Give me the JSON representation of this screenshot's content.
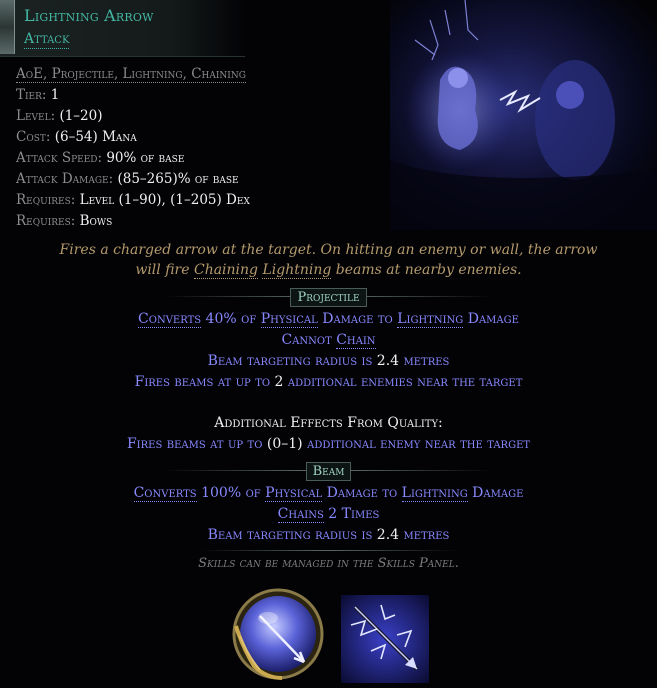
{
  "header": {
    "title": "Lightning Arrow",
    "subtitle": "Attack"
  },
  "stats": {
    "tags": "AoE, Projectile, Lightning, Chaining",
    "tier_label": "Tier:",
    "tier_value": "1",
    "level_label": "Level:",
    "level_value": "(1–20)",
    "cost_label": "Cost:",
    "cost_value": "(6–54) Mana",
    "attack_speed_label": "Attack Speed:",
    "attack_speed_value": "90% of base",
    "attack_damage_label": "Attack Damage:",
    "attack_damage_value": "(85–265)% of base",
    "requires1_label": "Requires:",
    "requires1_value": "Level (1–90), (1–205) Dex",
    "requires2_label": "Requires:",
    "requires2_value": "Bows"
  },
  "description": {
    "line1": "Fires a charged arrow at the target. On hitting an enemy or wall, the arrow",
    "line2_pre": "will fire ",
    "line2_link1": "Chaining",
    "line2_sp": " ",
    "line2_link2": "Lightning",
    "line2_post": " beams at nearby enemies."
  },
  "projectile": {
    "label": "Projectile",
    "m1": {
      "a": "Converts",
      "b": " 40% of ",
      "c": "Physical",
      "d": " Damage to ",
      "e": "Lightning",
      "f": " Damage"
    },
    "m2": {
      "a": "Cannot ",
      "b": "Chain"
    },
    "m3": {
      "a": "Beam targeting radius is ",
      "b": "2.4",
      "c": " metres"
    },
    "m4": {
      "a": "Fires beams at up to ",
      "b": "2",
      "c": " additional enemies near the target"
    }
  },
  "quality": {
    "heading": "Additional Effects From Quality:",
    "m1": {
      "a": "Fires beams at up to ",
      "b": "(0–1)",
      "c": " additional enemy near the target"
    }
  },
  "beam": {
    "label": "Beam",
    "m1": {
      "a": "Converts",
      "b": " 100% of ",
      "c": "Physical",
      "d": " Damage to ",
      "e": "Lightning",
      "f": " Damage"
    },
    "m2": {
      "a": "Chains",
      "b": " 2 Times"
    },
    "m3": {
      "a": "Beam targeting radius is ",
      "b": "2.4",
      "c": " metres"
    }
  },
  "footer": "Skills can be managed in the Skills Panel.",
  "colors": {
    "header": "#44b7a4",
    "magic_mod": "#8888ff",
    "flavour": "#b49a6c",
    "label_grey": "#8c8c8c"
  },
  "icons": {
    "gem": "lightning-arrow-gem-icon",
    "skill": "lightning-arrow-skill-icon"
  }
}
